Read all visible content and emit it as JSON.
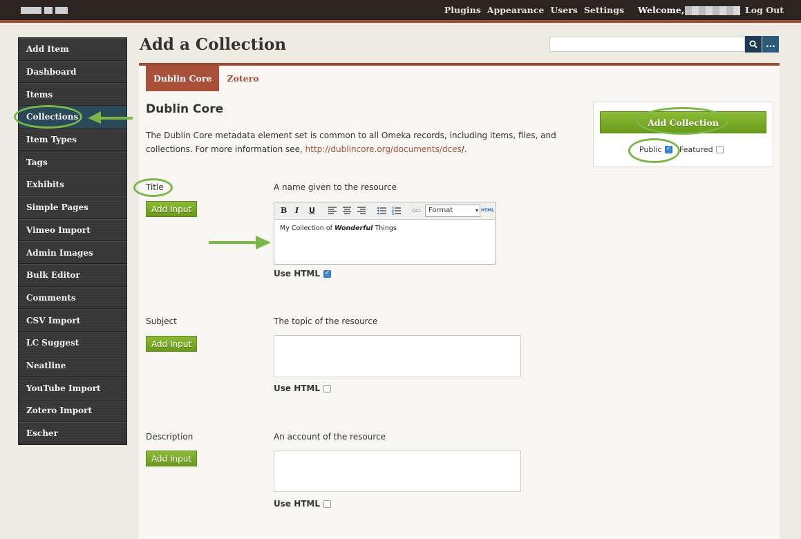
{
  "topbar": {
    "nav": [
      "Plugins",
      "Appearance",
      "Users",
      "Settings"
    ],
    "welcome": "Welcome,",
    "logout": "Log Out"
  },
  "sidebar": {
    "items": [
      {
        "label": "Add Item"
      },
      {
        "label": "Dashboard"
      },
      {
        "label": "Items"
      },
      {
        "label": "Collections"
      },
      {
        "label": "Item Types"
      },
      {
        "label": "Tags"
      },
      {
        "label": "Exhibits"
      },
      {
        "label": "Simple Pages"
      },
      {
        "label": "Vimeo Import"
      },
      {
        "label": "Admin Images"
      },
      {
        "label": "Bulk Editor"
      },
      {
        "label": "Comments"
      },
      {
        "label": "CSV Import"
      },
      {
        "label": "LC Suggest"
      },
      {
        "label": "Neatline"
      },
      {
        "label": "YouTube Import"
      },
      {
        "label": "Zotero Import"
      },
      {
        "label": "Escher"
      }
    ],
    "active_item": "Collections"
  },
  "header": {
    "title": "Add a Collection",
    "search_value": "",
    "search_icon": "magnifier",
    "advanced_label": "..."
  },
  "tabs": [
    {
      "label": "Dublin Core"
    },
    {
      "label": "Zotero"
    }
  ],
  "section": {
    "heading": "Dublin Core",
    "intro": "The Dublin Core metadata element set is common to all Omeka records, including items, files, and collections. For more information see, ",
    "link": "http://dublincore.org/documents/dces",
    "intro_end": "/."
  },
  "fields": [
    {
      "label": "Title",
      "description": "A name given to the resource",
      "add_input": "Add Input",
      "use_html": "Use HTML",
      "use_html_checked": true,
      "value_before": "My Collection of ",
      "value_emphasis": "Wonderful",
      "value_after": " Things"
    },
    {
      "label": "Subject",
      "description": "The topic of the resource",
      "add_input": "Add Input",
      "use_html": "Use HTML",
      "use_html_checked": false
    },
    {
      "label": "Description",
      "description": "An account of the resource",
      "add_input": "Add Input",
      "use_html": "Use HTML",
      "use_html_checked": false
    }
  ],
  "editor": {
    "toolbar": [
      "B",
      "I",
      "U"
    ],
    "format_label": "Format",
    "html_label": "HTML"
  },
  "save_panel": {
    "button": "Add Collection",
    "public_label": "Public",
    "public_checked": true,
    "featured_label": "Featured",
    "featured_checked": false
  },
  "colors": {
    "topbar": "#2b2421",
    "accent": "#a9503a",
    "button_green": "#7aab28",
    "annotation_green": "#7ab648",
    "sidebar": "#3a3a3a"
  }
}
